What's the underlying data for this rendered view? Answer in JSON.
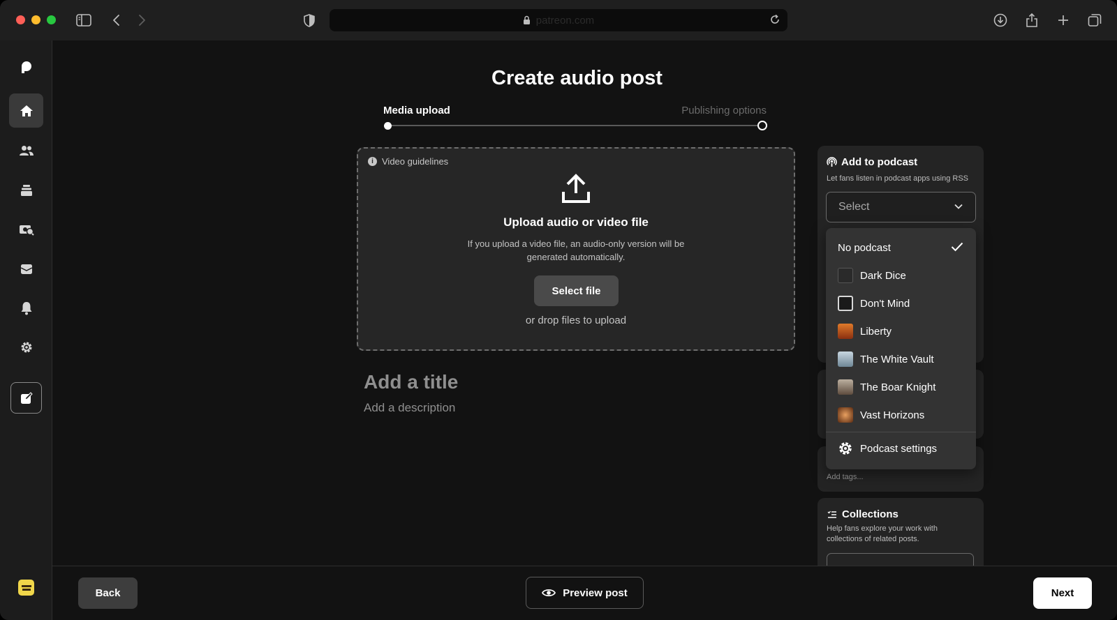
{
  "browser": {
    "url": "patreon.com"
  },
  "page": {
    "title": "Create audio post"
  },
  "steps": {
    "current": "Media upload",
    "next": "Publishing options"
  },
  "upload": {
    "guidelines": "Video guidelines",
    "title": "Upload audio or video file",
    "subtitle": "If you upload a video file, an audio-only version will be generated automatically.",
    "button": "Select file",
    "drop_text": "or drop files to upload"
  },
  "post": {
    "title_placeholder": "Add a title",
    "description_placeholder": "Add a description"
  },
  "podcast": {
    "title": "Add to podcast",
    "subtitle": "Let fans listen in podcast apps using RSS",
    "select_value": "Select",
    "options": [
      {
        "label": "No podcast",
        "selected": true
      },
      {
        "label": "Dark Dice",
        "color": "#3a3a3a"
      },
      {
        "label": "Don't Mind",
        "color": "#d8d8d8"
      },
      {
        "label": "Liberty",
        "color": "#c0541c"
      },
      {
        "label": "The White Vault",
        "color": "#9fb4c4"
      },
      {
        "label": "The Boar Knight",
        "color": "#8c7a6a"
      },
      {
        "label": "Vast Horizons",
        "color": "#b8642a"
      }
    ],
    "settings_label": "Podcast settings"
  },
  "tags": {
    "placeholder": "Add tags..."
  },
  "collections": {
    "title": "Collections",
    "subtitle": "Help fans explore your work with collections of related posts."
  },
  "footer": {
    "back": "Back",
    "preview": "Preview post",
    "next": "Next"
  }
}
